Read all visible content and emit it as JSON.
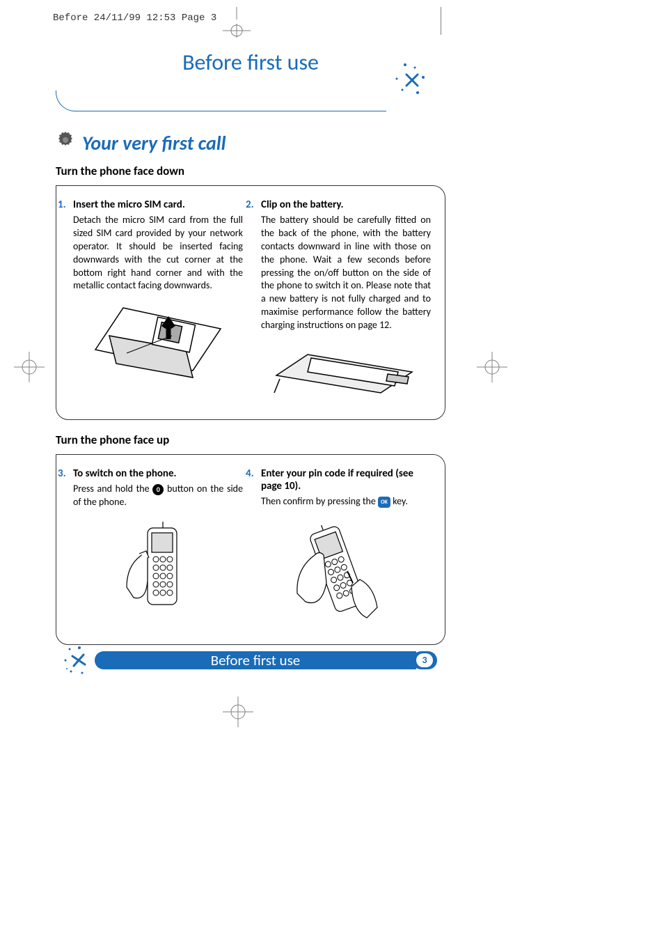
{
  "print_header": "Before  24/11/99 12:53  Page 3",
  "page_title": "Before first use",
  "section": "Your very first call",
  "sub1": "Turn the phone face down",
  "sub2": "Turn the phone face up",
  "steps": {
    "s1": {
      "num": "1.",
      "title": "Insert the micro SIM card.",
      "body": "Detach the micro SIM card from the full sized SIM card provided by your network operator. It should be inserted facing downwards with the cut corner at the bottom right hand corner and with the metallic contact facing downwards."
    },
    "s2": {
      "num": "2.",
      "title": "Clip on the battery.",
      "body": "The battery should be carefully fitted on the back of the phone, with the battery contacts downward in line with those on the phone.  Wait a few seconds before pressing the on/off button on the side of the phone to switch it on.  Please note that a new battery is not fully charged and to maximise performance follow the battery charging instructions on page 12."
    },
    "s3": {
      "num": "3.",
      "title": "To switch on the phone.",
      "body_a": "Press and hold the ",
      "body_b": " button on the side of the phone."
    },
    "s4": {
      "num": "4.",
      "title": "Enter your pin code if required (see page 10).",
      "body_a": "Then confirm by pressing the ",
      "body_b": " key."
    }
  },
  "footer_text": "Before first use",
  "page_num": "3",
  "icons": {
    "power": "0",
    "ok": "OK"
  }
}
